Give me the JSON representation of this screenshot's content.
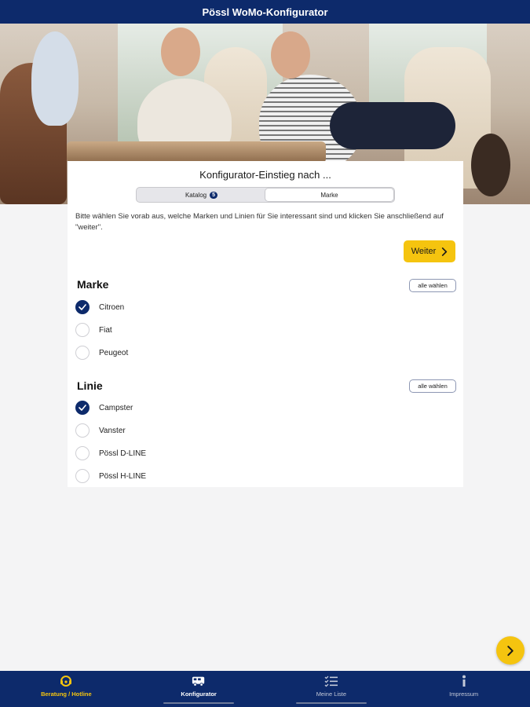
{
  "app": {
    "title": "Pössl WoMo-Konfigurator"
  },
  "card": {
    "title": "Konfigurator-Einstieg nach ...",
    "segments": [
      {
        "label": "Katalog",
        "badge": "5",
        "active": false
      },
      {
        "label": "Marke",
        "active": true
      }
    ],
    "intro": "Bitte wählen Sie vorab aus, welche Marken und Linien für Sie interessant sind und klicken Sie anschließend auf \"weiter\".",
    "weiter_label": "Weiter"
  },
  "marke": {
    "title": "Marke",
    "select_all": "alle wählen",
    "options": [
      {
        "label": "Citroen",
        "checked": true
      },
      {
        "label": "Fiat",
        "checked": false
      },
      {
        "label": "Peugeot",
        "checked": false
      }
    ]
  },
  "linie": {
    "title": "Linie",
    "select_all": "alle wählen",
    "options": [
      {
        "label": "Campster",
        "checked": true
      },
      {
        "label": "Vanster",
        "checked": false
      },
      {
        "label": "Pössl D-LINE",
        "checked": false
      },
      {
        "label": "Pössl H-LINE",
        "checked": false
      }
    ]
  },
  "tabs": [
    {
      "label": "Beratung / Hotline",
      "icon": "headset-icon"
    },
    {
      "label": "Konfigurator",
      "icon": "camper-van-icon",
      "active": true
    },
    {
      "label": "Meine Liste",
      "icon": "checklist-icon"
    },
    {
      "label": "Impressum",
      "icon": "info-icon"
    }
  ],
  "colors": {
    "navy": "#0d2a6b",
    "accent_yellow": "#f5c40f"
  }
}
